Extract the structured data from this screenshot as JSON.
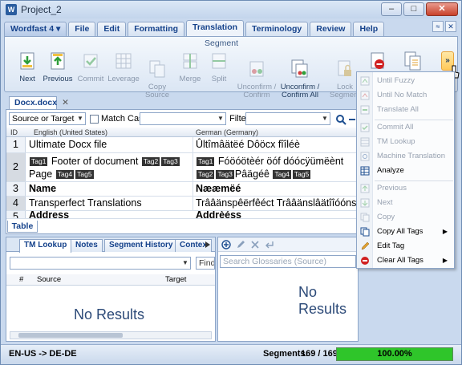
{
  "window": {
    "title": "Project_2",
    "min": "–",
    "max": "□",
    "close": "✕"
  },
  "menubar": {
    "items": [
      {
        "label": "Wordfast 4 ▾"
      },
      {
        "label": "File"
      },
      {
        "label": "Edit"
      },
      {
        "label": "Formatting"
      },
      {
        "label": "Translation"
      },
      {
        "label": "Terminology"
      },
      {
        "label": "Review"
      },
      {
        "label": "Help"
      }
    ],
    "active": "Translation",
    "ribbon_controls": [
      "≈",
      "✕"
    ]
  },
  "ribbon": {
    "group_title": "Segment",
    "buttons": [
      {
        "label": "Next",
        "icon": "next-icon",
        "enabled": true
      },
      {
        "label": "Previous",
        "icon": "previous-icon",
        "enabled": true
      },
      {
        "label": "Commit",
        "icon": "commit-icon",
        "enabled": false
      },
      {
        "label": "Leverage",
        "icon": "leverage-icon",
        "enabled": false
      },
      {
        "label": "Copy\nSource",
        "icon": "copy-source-icon",
        "enabled": false
      },
      {
        "label": "Merge",
        "icon": "merge-icon",
        "enabled": false
      },
      {
        "label": "Split",
        "icon": "split-icon",
        "enabled": false
      },
      {
        "label": "Unconfirm /\nConfirm",
        "icon": "unconfirm-icon",
        "enabled": false
      },
      {
        "label": "Unconfirm /\nConfirm All",
        "icon": "unconfirm-all-icon",
        "enabled": true
      },
      {
        "label": "Lock\nSegment",
        "icon": "lock-icon",
        "enabled": false
      },
      {
        "label": "",
        "icon": "stop-icon",
        "enabled": true
      },
      {
        "label": "",
        "icon": "pages-icon",
        "enabled": true
      }
    ],
    "more": "»"
  },
  "document": {
    "tab": "Docx.docx",
    "close": "✕",
    "filter": {
      "scope": "Source or Target",
      "match_case": "Match Case",
      "filter_label": "Filter:"
    },
    "columns": {
      "id": "ID",
      "source": "English (United States)",
      "target": "German (Germany)"
    },
    "rows": [
      {
        "id": "1",
        "source": "Ultimate Docx file",
        "target": "Ûltîmâätëé Dôöcx fîîléè"
      },
      {
        "id": "2",
        "source_a": "Footer of document",
        "source_b": "Page",
        "target_a": "Fóöóötèér öóf dóócÿümëènt",
        "target_b": "Pâägéê"
      },
      {
        "id": "3",
        "source": "Name",
        "target": "Nææmëé"
      },
      {
        "id": "4",
        "source": "Transperfect Translations",
        "target": "Trââänspêërfêéct Trââänslâätîîóóns"
      },
      {
        "id": "5",
        "source": "Address",
        "target": "Âddrèéss"
      }
    ],
    "tags": [
      "Tag1",
      "Tag2",
      "Tag3",
      "Tag4",
      "Tag5"
    ],
    "bottom_tab": "Table"
  },
  "lower_left": {
    "tabs": [
      "TM Lookup",
      "Notes",
      "Segment History",
      "Contex"
    ],
    "find": "Find",
    "columns": [
      "#",
      "Source",
      "Target"
    ],
    "empty": "No Results"
  },
  "lower_right": {
    "search_placeholder": "Search Glossaries (Source)",
    "empty": "No Results"
  },
  "statusbar": {
    "lang": "EN-US -> DE-DE",
    "segments_label": "Segments:",
    "segments_value": "169 / 169",
    "progress": 1.0,
    "progress_label": "100.00%"
  },
  "dropdown": {
    "items": [
      {
        "label": "Until Fuzzy",
        "enabled": false,
        "icon": "fuzzy-icon"
      },
      {
        "label": "Until No Match",
        "enabled": false,
        "icon": "no-match-icon"
      },
      {
        "label": "Translate All",
        "enabled": false,
        "icon": "translate-all-icon"
      },
      {
        "label": "Commit All",
        "enabled": false,
        "icon": "commit-all-icon"
      },
      {
        "label": "TM Lookup",
        "enabled": false,
        "icon": "tm-lookup-icon"
      },
      {
        "label": "Machine Translation",
        "enabled": false,
        "icon": "machine-translation-icon"
      },
      {
        "label": "Analyze",
        "enabled": true,
        "icon": "analyze-icon"
      },
      {
        "label": "Previous",
        "enabled": false,
        "icon": "previous-tag-icon"
      },
      {
        "label": "Next",
        "enabled": false,
        "icon": "next-tag-icon"
      },
      {
        "label": "Copy",
        "enabled": false,
        "icon": "copy-icon"
      },
      {
        "label": "Copy All Tags",
        "enabled": true,
        "icon": "copy-all-tags-icon",
        "submenu": true
      },
      {
        "label": "Edit Tag",
        "enabled": true,
        "icon": "edit-tag-icon"
      },
      {
        "label": "Clear All Tags",
        "enabled": true,
        "icon": "clear-tags-icon",
        "submenu": true
      }
    ]
  },
  "colors": {
    "accent": "#15428b",
    "progress": "#2fc52a",
    "ribbon": "#dbe6f4"
  }
}
